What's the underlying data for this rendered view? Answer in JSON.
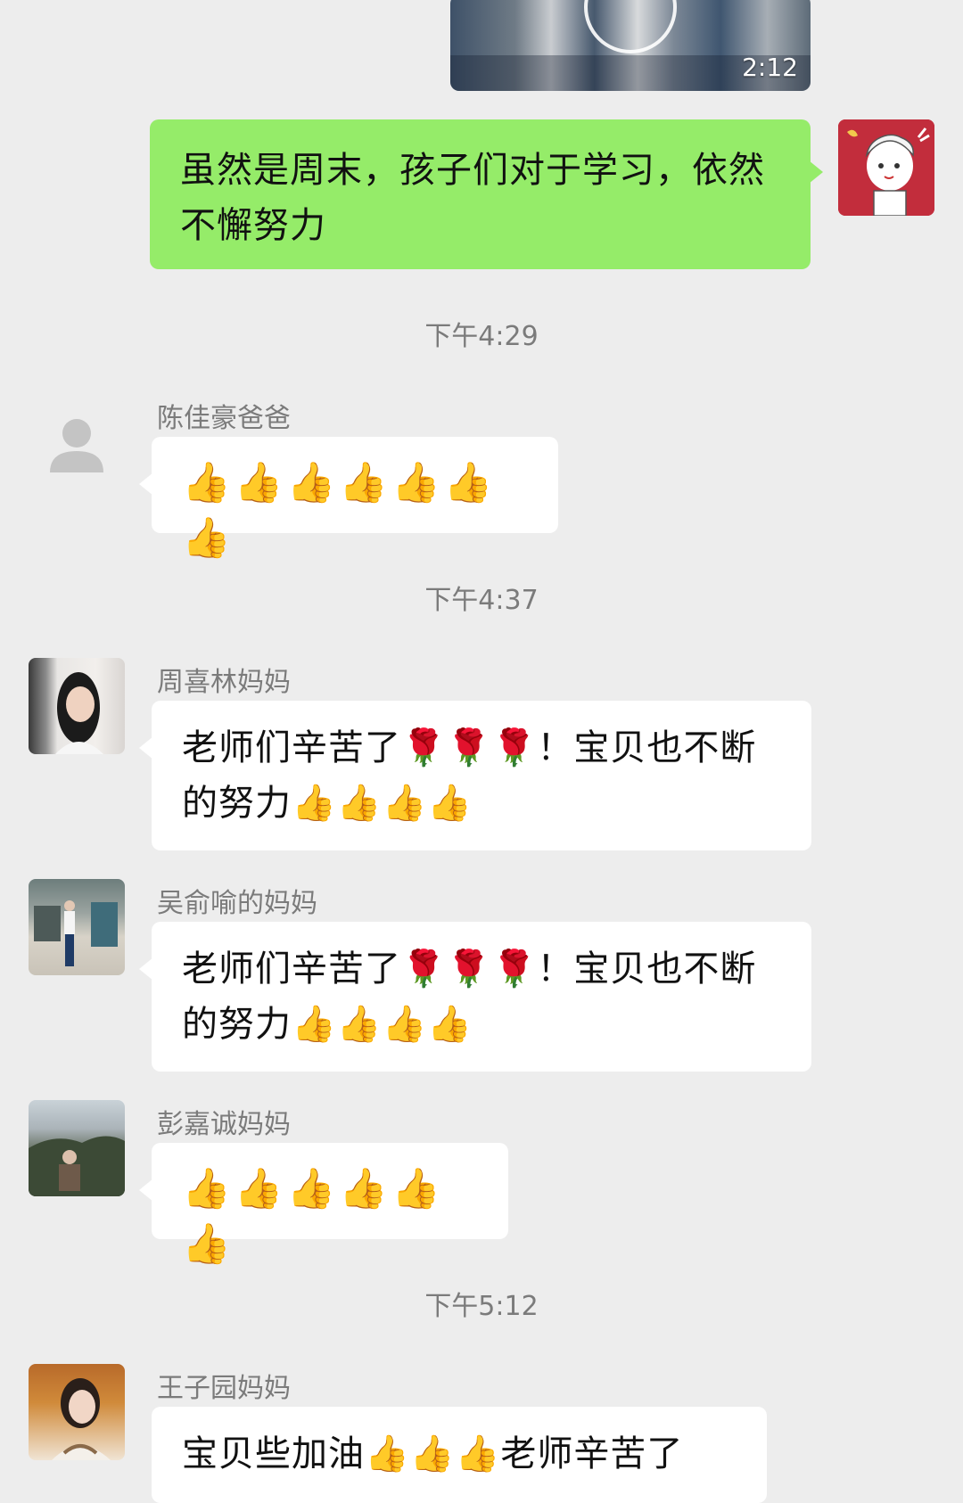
{
  "video": {
    "duration": "2:12"
  },
  "outgoing": {
    "text": "虽然是周末，孩子们对于学习，依然不懈努力"
  },
  "messages": [
    {
      "time": "下午4:29",
      "sender": "陈佳豪爸爸",
      "text": "👍👍👍👍👍👍👍"
    },
    {
      "time": "下午4:37",
      "sender": "周喜林妈妈",
      "text": "老师们辛苦了🌹🌹🌹！宝贝也不断的努力👍👍👍👍"
    },
    {
      "sender": "吴俞喻的妈妈",
      "text": "老师们辛苦了🌹🌹🌹！宝贝也不断的努力👍👍👍👍"
    },
    {
      "sender": "彭嘉诚妈妈",
      "text": "👍👍👍👍👍👍"
    },
    {
      "time": "下午5:12",
      "sender": "王子园妈妈",
      "text": "宝贝些加油👍👍👍老师辛苦了"
    }
  ]
}
